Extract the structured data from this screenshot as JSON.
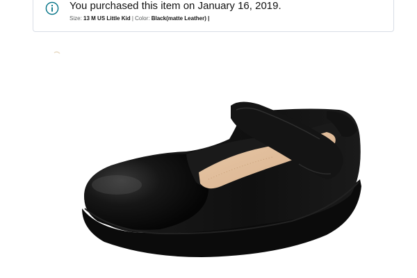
{
  "purchase_notice": {
    "info_icon": "info-icon",
    "message": "You purchased this item on January 16, 2019.",
    "size_label": "Size:",
    "size_value": "13 M US Little Kid",
    "separator": "|",
    "color_label": "Color:",
    "color_value": "Black(matte Leather)",
    "trailing_separator": "|",
    "accent_color": "#007185"
  },
  "product_image": {
    "subject": "black-mary-jane-shoe"
  }
}
